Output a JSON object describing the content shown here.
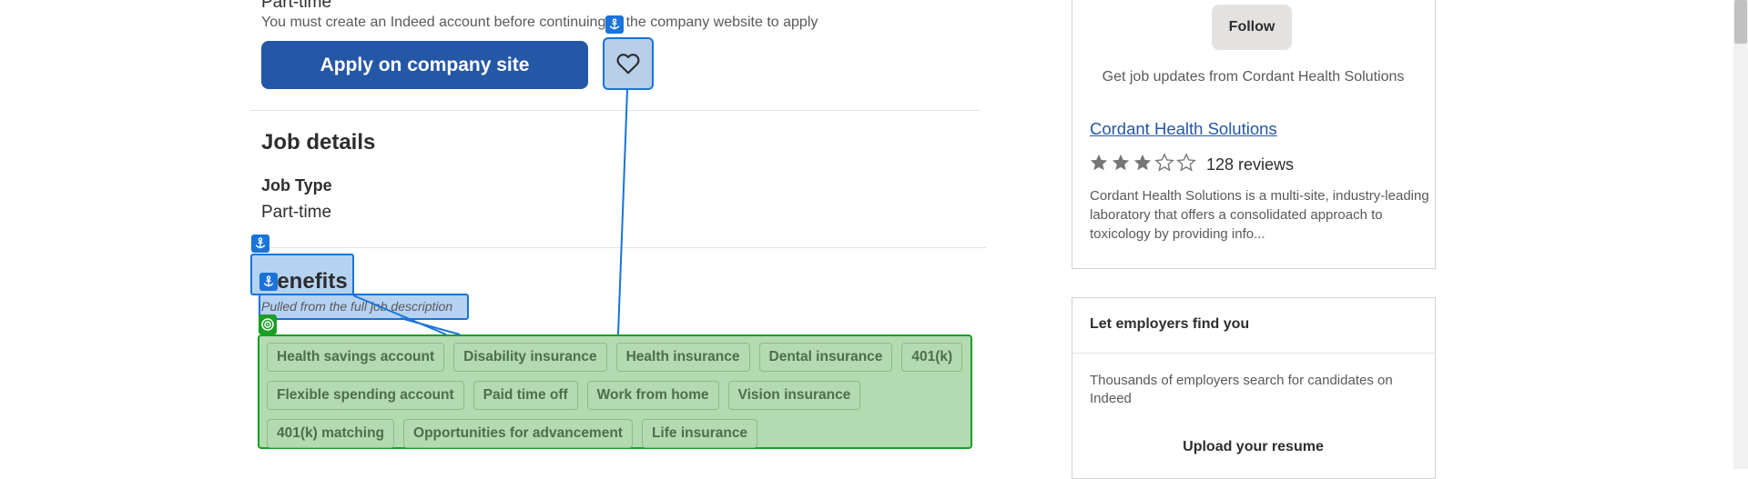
{
  "job": {
    "top_job_type": "Part-time",
    "notice": "You must create an Indeed account before continuing to the company website to apply",
    "apply_label": "Apply on company site",
    "details_title": "Job details",
    "job_type_label": "Job Type",
    "job_type_value": "Part-time",
    "benefits_title": "Benefits",
    "benefits_subtitle": "Pulled from the full job description",
    "benefits": [
      "Health savings account",
      "Disability insurance",
      "Health insurance",
      "Dental insurance",
      "401(k)",
      "Flexible spending account",
      "Paid time off",
      "Work from home",
      "Vision insurance",
      "401(k) matching",
      "Opportunities for advancement",
      "Life insurance"
    ]
  },
  "company": {
    "follow_label": "Follow",
    "updates_text": "Get job updates from Cordant Health Solutions",
    "name": "Cordant Health Solutions",
    "rating": 3,
    "rating_max": 5,
    "reviews": "128 reviews",
    "description": "Cordant Health Solutions is a multi-site, industry-leading laboratory that offers a consolidated approach to toxicology by providing info..."
  },
  "employers_card": {
    "title": "Let employers find you",
    "text": "Thousands of employers search for candidates on Indeed",
    "upload_label": "Upload your resume"
  },
  "icons": {
    "save": "heart-icon",
    "anchor": "anchor-icon",
    "target": "target-icon",
    "star": "star-icon"
  },
  "colors": {
    "primary": "#2557a7",
    "annotation_blue": "#1a73d9",
    "annotation_green": "#1a9e24",
    "star": "#767676"
  }
}
